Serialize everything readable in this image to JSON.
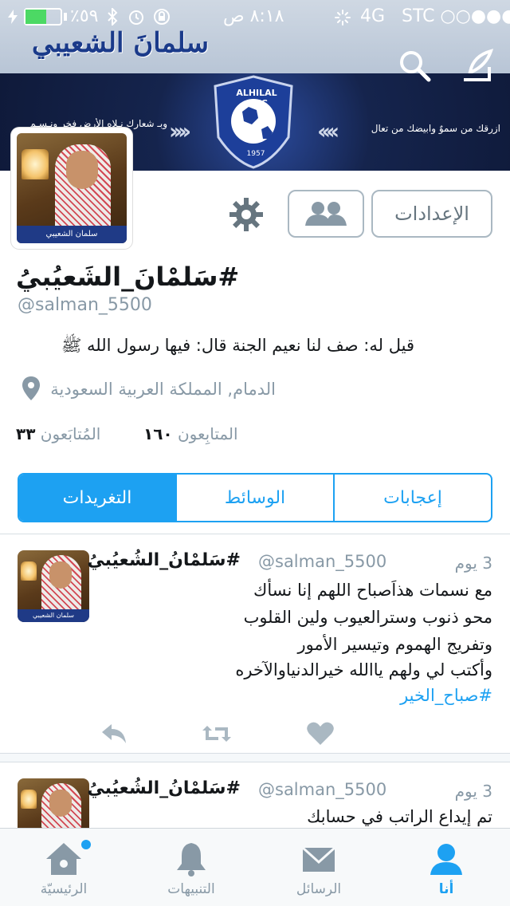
{
  "status_bar": {
    "carrier": "STC ○○●●●",
    "network": "4G",
    "time": "٨:١٨ ص",
    "battery_percent": "٪٥٩",
    "battery_level": 0.59
  },
  "header": {
    "banner_title": "سلمانَ الشعيبي",
    "banner_slogan_left": "وبـ شعارك نـلاه الأرض فخر ونـسـم",
    "banner_slogan_right": "ازرقك من سموٌ وابيضك من تعال",
    "crest_text": "ALHILAL S.FC",
    "crest_year": "1957",
    "search_icon": "search-icon",
    "compose_icon": "compose-icon"
  },
  "profile": {
    "avatar_caption": "سلمان الشعيبي",
    "settings_button": "الإعدادات",
    "display_name": "#سَلمْانَ_الشَعيُبيُ",
    "handle": "@salman_5500",
    "bio": "قيل له: صف لنا نعيم الجنة قال: فيها رسول الله ﷺ",
    "location": "الدمام, المملكة العربية السعودية",
    "followers_count": "١٦٠",
    "followers_label": "المتابِعون",
    "following_count": "٣٣",
    "following_label": "المُتابَعون"
  },
  "tabs": {
    "likes": "إعجابات",
    "media": "الوسائط",
    "tweets": "التغريدات",
    "active": "tweets"
  },
  "tweets": [
    {
      "time": "3 يوم",
      "handle": "@salman_5500",
      "name": "#سَلمْانُ_الشُعيُبيُ",
      "lines": [
        "مع نسمات هذاَصباح اللهم إنا نسأك",
        "محو ذنوب وسترالعيوب ولين القلوب",
        "وتفريج الهموم وتيسير الأمور",
        "وأكتب لي ولهم ياالله خيرالدنياوالآخره"
      ],
      "hashtag": "#صباح_الخير"
    },
    {
      "time": "3 يوم",
      "handle": "@salman_5500",
      "name": "#سَلمْانُ_الشُعيُبيُ",
      "lines": [
        "تم إيداع الراتب في حسابك"
      ]
    }
  ],
  "tabbar": {
    "home": "الرئيسيّة",
    "notifications": "التنبيهات",
    "messages": "الرسائل",
    "me": "أنا",
    "active": "me"
  },
  "colors": {
    "accent": "#1da1f2",
    "muted": "#8899a6",
    "text": "#14171a"
  }
}
